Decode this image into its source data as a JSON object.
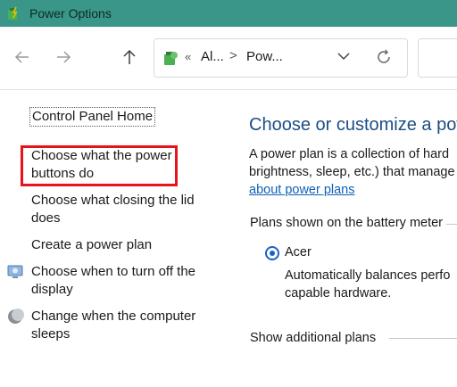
{
  "window": {
    "title": "Power Options"
  },
  "address_bar": {
    "separator": "«",
    "crumb_1": "Al...",
    "crumb_chevron": ">",
    "crumb_2": "Pow..."
  },
  "sidebar": {
    "home_link": "Control Panel Home",
    "items": [
      {
        "label_line1": "Choose what the power",
        "label_line2": "buttons do",
        "highlighted": true
      },
      {
        "label_line1": "Choose what closing the lid",
        "label_line2": "does"
      },
      {
        "label_line1": "Create a power plan"
      },
      {
        "label_line1": "Choose when to turn off the",
        "label_line2": "display",
        "icon": "monitor-icon"
      },
      {
        "label_line1": "Change when the computer",
        "label_line2": "sleeps",
        "icon": "moon-icon"
      }
    ]
  },
  "main": {
    "title": "Choose or customize a pow",
    "desc_line1": "A power plan is a collection of hard",
    "desc_line2": "brightness, sleep, etc.) that manage",
    "desc_link": "about power plans",
    "section_label": "Plans shown on the battery meter",
    "plan": {
      "name": "Acer",
      "selected": true,
      "desc_line1": "Automatically balances perfo",
      "desc_line2": "capable hardware."
    },
    "show_additional": "Show additional plans"
  },
  "colors": {
    "titlebar": "#3a9689",
    "link_title": "#1b4e85",
    "link": "#1060b8",
    "highlight_box": "#e8121c",
    "radio": "#1b62c7"
  }
}
